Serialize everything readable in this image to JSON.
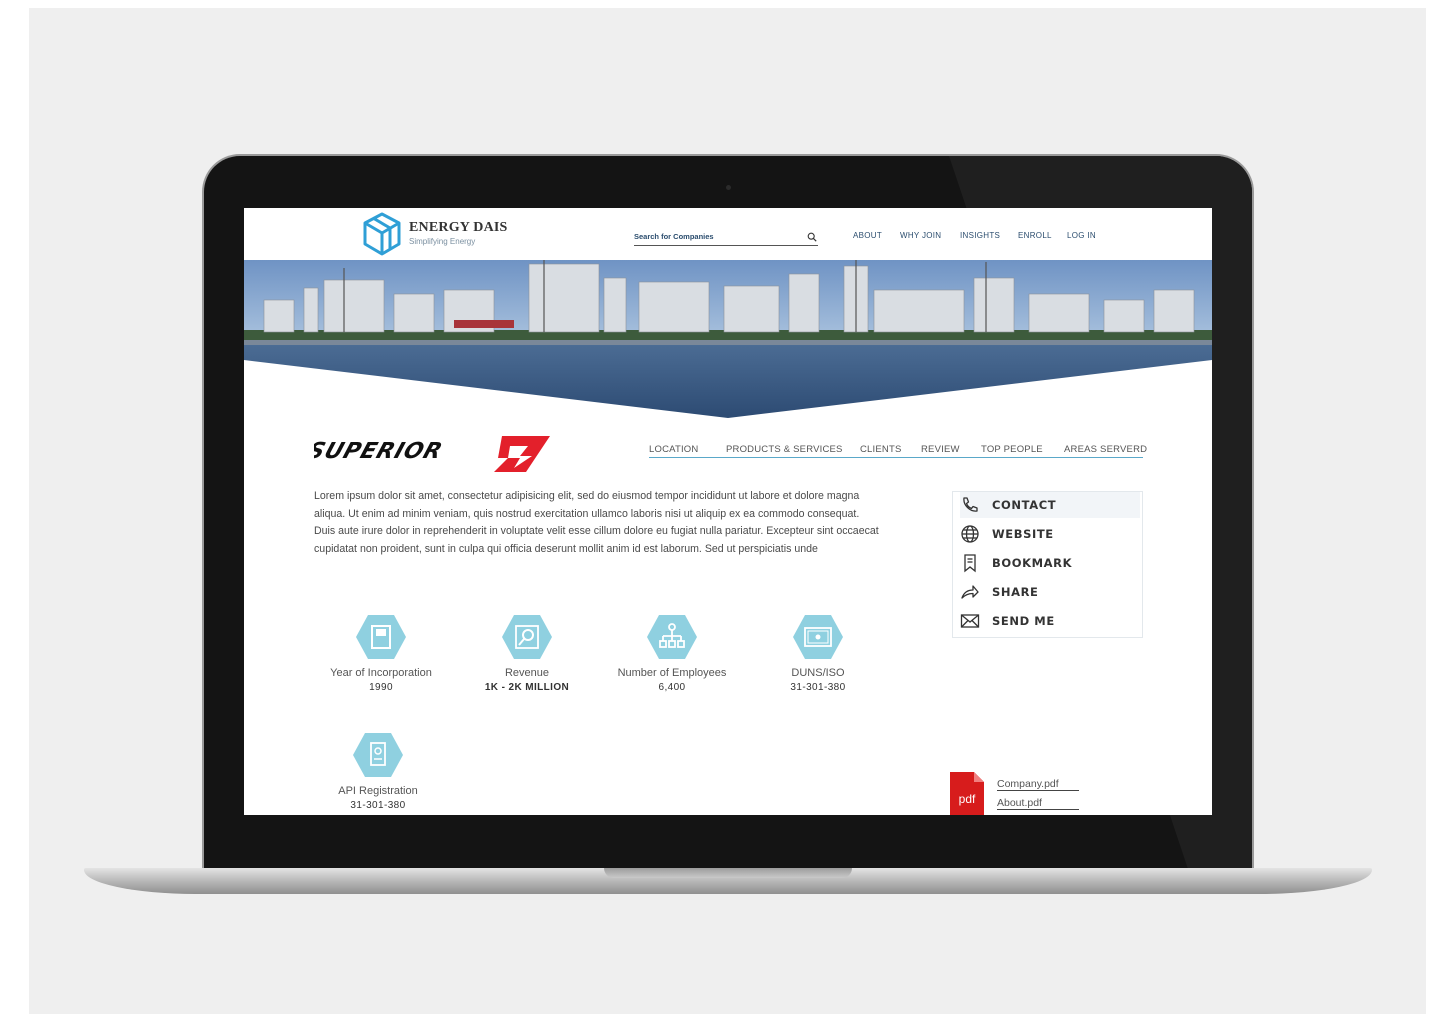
{
  "header": {
    "brand": "ENERGY DAIS",
    "tagline": "Simplifying Energy",
    "search_placeholder": "Search for Companies",
    "nav": [
      "ABOUT",
      "WHY JOIN",
      "INSIGHTS",
      "ENROLL",
      "LOG IN"
    ]
  },
  "company": {
    "logo_text": "SUPERIOR",
    "tabs": [
      "LOCATION",
      "PRODUCTS & SERVICES",
      "CLIENTS",
      "REVIEW",
      "TOP PEOPLE",
      "AREAS SERVERD"
    ],
    "description": "Lorem ipsum dolor sit amet, consectetur adipisicing elit, sed do eiusmod tempor incididunt ut labore et dolore magna aliqua. Ut enim ad minim veniam, quis nostrud exercitation ullamco laboris nisi ut aliquip ex ea commodo consequat. Duis aute irure dolor in reprehenderit in voluptate velit esse cillum dolore eu fugiat nulla pariatur. Excepteur sint occaecat cupidatat non proident, sunt in culpa qui officia deserunt mollit anim id est laborum. Sed ut perspiciatis unde"
  },
  "stats": [
    {
      "label": "Year of Incorporation",
      "value": "1990",
      "icon": "document-icon"
    },
    {
      "label": "Revenue",
      "value": "1K - 2K MILLION",
      "icon": "revenue-search-icon"
    },
    {
      "label": "Number of Employees",
      "value": "6,400",
      "icon": "org-chart-icon"
    },
    {
      "label": "DUNS/ISO",
      "value": "31-301-380",
      "icon": "certificate-icon"
    },
    {
      "label": "API Registration",
      "value": "31-301-380",
      "icon": "id-badge-icon"
    }
  ],
  "actions": [
    "CONTACT",
    "WEBSITE",
    "BOOKMARK",
    "SHARE",
    "SEND ME"
  ],
  "files": {
    "pdf_badge": "pdf",
    "items": [
      "Company.pdf",
      "About.pdf"
    ]
  },
  "colors": {
    "accent": "#5aa8c9",
    "hex_fill": "#8fd0e0",
    "brand_blue": "#2b4d6e",
    "logo_red": "#e3202b"
  }
}
